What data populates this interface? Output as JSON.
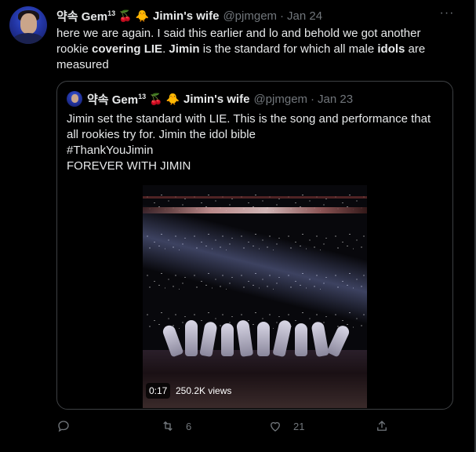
{
  "tweet": {
    "display_name": "약속 Gem",
    "display_name_sup": "13",
    "display_name_suffix": "Jimin's wife",
    "handle": "@pjmgem",
    "separator": "·",
    "date": "Jan 24",
    "text_parts": [
      {
        "text": "here we are again. I said this earlier and lo and behold we got another rookie ",
        "bold": false
      },
      {
        "text": "covering LIE",
        "bold": true
      },
      {
        "text": ". ",
        "bold": false
      },
      {
        "text": "Jimin",
        "bold": true
      },
      {
        "text": " is the standard for which all male ",
        "bold": false
      },
      {
        "text": "idols",
        "bold": true
      },
      {
        "text": " are measured",
        "bold": false
      }
    ],
    "more_label": "···"
  },
  "quoted": {
    "display_name": "약속 Gem",
    "display_name_sup": "13",
    "display_name_suffix": "Jimin's wife",
    "handle": "@pjmgem",
    "separator": "·",
    "date": "Jan 23",
    "lines": [
      "Jimin set the standard with LIE. This is the song and performance that all rookies try for. Jimin the idol bible",
      "#ThankYouJimin",
      "FOREVER WITH JIMIN"
    ],
    "video": {
      "timestamp": "0:17",
      "views": "250.2K views"
    }
  },
  "actions": {
    "reply_count": "",
    "retweet_count": "6",
    "like_count": "21",
    "share_count": ""
  },
  "icons": {
    "emoji_1": "cherries",
    "emoji_2": "baby-chick"
  },
  "colors": {
    "background": "#000000",
    "text": "#e7e9ea",
    "muted": "#71767b",
    "border": "#3e4144"
  }
}
